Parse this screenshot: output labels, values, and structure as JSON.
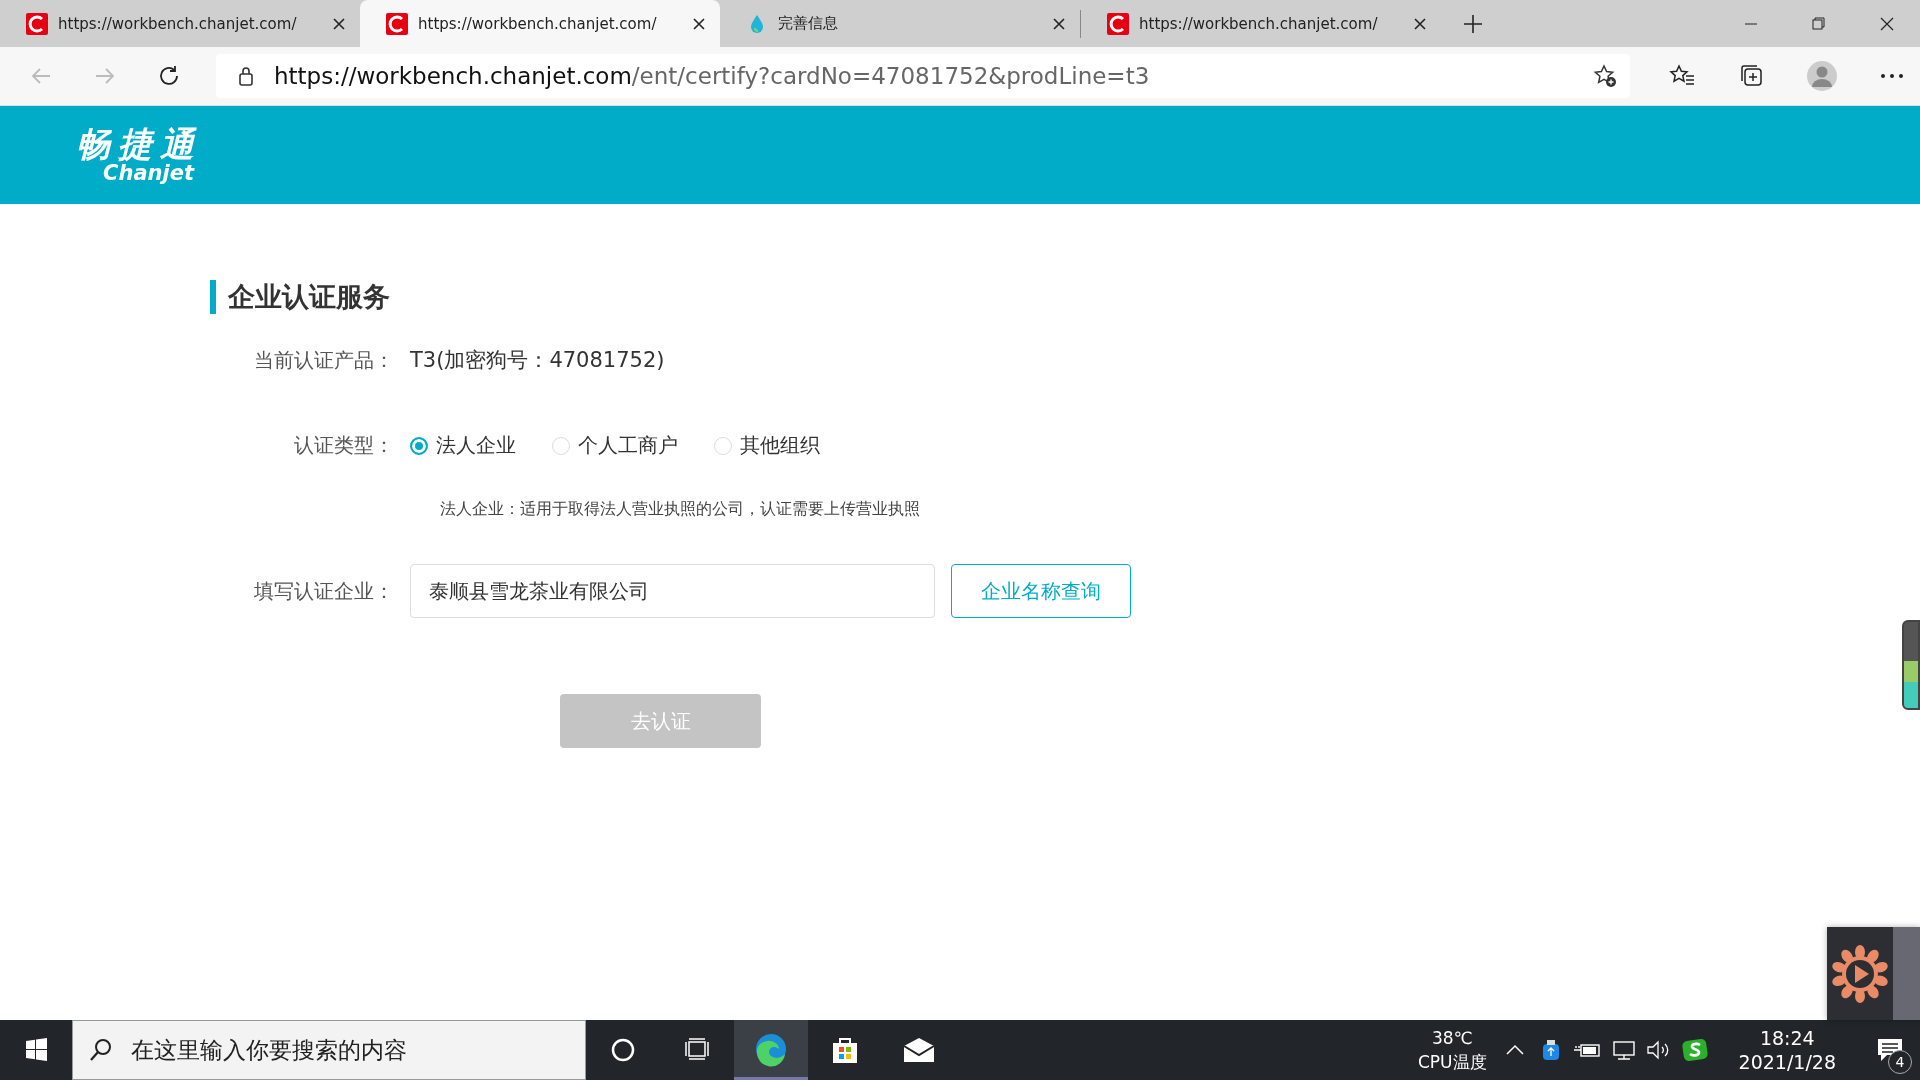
{
  "browser": {
    "tabs": [
      {
        "title": "https://workbench.chanjet.com/",
        "kind": "chanjet",
        "selected": false
      },
      {
        "title": "https://workbench.chanjet.com/",
        "kind": "chanjet",
        "selected": true
      },
      {
        "title": "完善信息",
        "kind": "drop",
        "selected": false
      },
      {
        "title": "https://workbench.chanjet.com/",
        "kind": "chanjet",
        "selected": false
      }
    ],
    "url": {
      "host": "https://workbench.chanjet.com",
      "path": "/ent/certify?cardNo=47081752&prodLine=t3"
    }
  },
  "header": {
    "logo_cn": "畅捷通",
    "logo_en": "Chanjet"
  },
  "page": {
    "title": "企业认证服务",
    "product": {
      "label": "当前认证产品：",
      "value": "T3(加密狗号：47081752)"
    },
    "type": {
      "label": "认证类型：",
      "options": [
        {
          "label": "法人企业",
          "selected": true
        },
        {
          "label": "个人工商户",
          "selected": false
        },
        {
          "label": "其他组织",
          "selected": false
        }
      ],
      "hint": "法人企业：适用于取得法人营业执照的公司，认证需要上传营业执照"
    },
    "company": {
      "label": "填写认证企业：",
      "value": "泰顺县雪龙茶业有限公司",
      "button": "企业名称查询"
    },
    "submit": {
      "label": "去认证",
      "disabled": true
    }
  },
  "taskbar": {
    "search_placeholder": "在这里输入你要搜索的内容",
    "apps": [
      {
        "kind": "cortana",
        "selected": false
      },
      {
        "kind": "taskview",
        "selected": false
      },
      {
        "kind": "edge",
        "selected": true
      },
      {
        "kind": "store",
        "selected": false
      },
      {
        "kind": "mail",
        "selected": false
      }
    ],
    "temp": "38℃",
    "temp_label": "CPU温度",
    "time": "18:24",
    "date": "2021/1/28",
    "notifications": "4"
  }
}
